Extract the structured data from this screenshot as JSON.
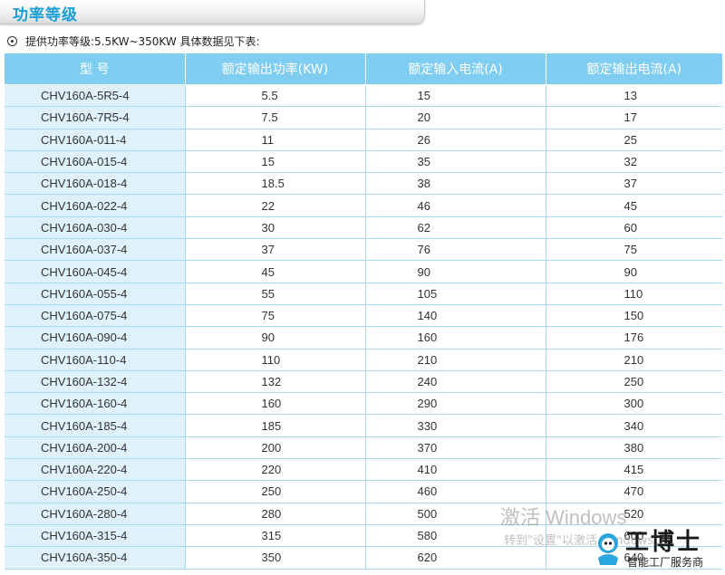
{
  "section": {
    "title": "功率等级"
  },
  "intro": {
    "text": "提供功率等级:5.5KW~350KW  具体数据见下表:"
  },
  "table": {
    "headers": [
      "型    号",
      "额定输出功率(KW)",
      "额定输入电流(A)",
      "额定输出电流(A)"
    ],
    "rows": [
      [
        "CHV160A-5R5-4",
        "5.5",
        "15",
        "13"
      ],
      [
        "CHV160A-7R5-4",
        "7.5",
        "20",
        "17"
      ],
      [
        "CHV160A-011-4",
        "11",
        "26",
        "25"
      ],
      [
        "CHV160A-015-4",
        "15",
        "35",
        "32"
      ],
      [
        "CHV160A-018-4",
        "18.5",
        "38",
        "37"
      ],
      [
        "CHV160A-022-4",
        "22",
        "46",
        "45"
      ],
      [
        "CHV160A-030-4",
        "30",
        "62",
        "60"
      ],
      [
        "CHV160A-037-4",
        "37",
        "76",
        "75"
      ],
      [
        "CHV160A-045-4",
        "45",
        "90",
        "90"
      ],
      [
        "CHV160A-055-4",
        "55",
        "105",
        "110"
      ],
      [
        "CHV160A-075-4",
        "75",
        "140",
        "150"
      ],
      [
        "CHV160A-090-4",
        "90",
        "160",
        "176"
      ],
      [
        "CHV160A-110-4",
        "110",
        "210",
        "210"
      ],
      [
        "CHV160A-132-4",
        "132",
        "240",
        "250"
      ],
      [
        "CHV160A-160-4",
        "160",
        "290",
        "300"
      ],
      [
        "CHV160A-185-4",
        "185",
        "330",
        "340"
      ],
      [
        "CHV160A-200-4",
        "200",
        "370",
        "380"
      ],
      [
        "CHV160A-220-4",
        "220",
        "410",
        "415"
      ],
      [
        "CHV160A-250-4",
        "250",
        "460",
        "470"
      ],
      [
        "CHV160A-280-4",
        "280",
        "500",
        "520"
      ],
      [
        "CHV160A-315-4",
        "315",
        "580",
        "600"
      ],
      [
        "CHV160A-350-4",
        "350",
        "620",
        "640"
      ]
    ]
  },
  "watermark": {
    "activate_title": "激活 Windows",
    "activate_sub": "转到\"设置\"以激活 Windows。",
    "logo_name": "工博士",
    "logo_sub": "智能工厂服务商"
  }
}
